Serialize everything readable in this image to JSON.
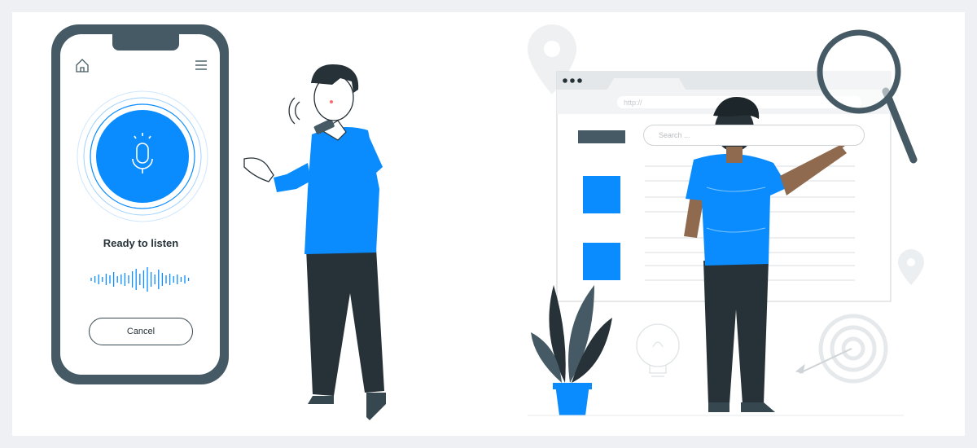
{
  "phone": {
    "status_title": "Ready to listen",
    "cancel_label": "Cancel",
    "icons": [
      "home-icon",
      "menu-icon",
      "microphone-icon"
    ]
  },
  "browser": {
    "url_text": "http://",
    "search_placeholder": "Search ...",
    "icons": [
      "search-icon",
      "magnifying-glass-icon",
      "location-pin-icon",
      "lightbulb-icon",
      "target-icon"
    ]
  },
  "colors": {
    "accent_blue": "#0a8cff",
    "dark": "#263238",
    "skin": "#8f6a4e",
    "light_gray": "#eceff1"
  }
}
